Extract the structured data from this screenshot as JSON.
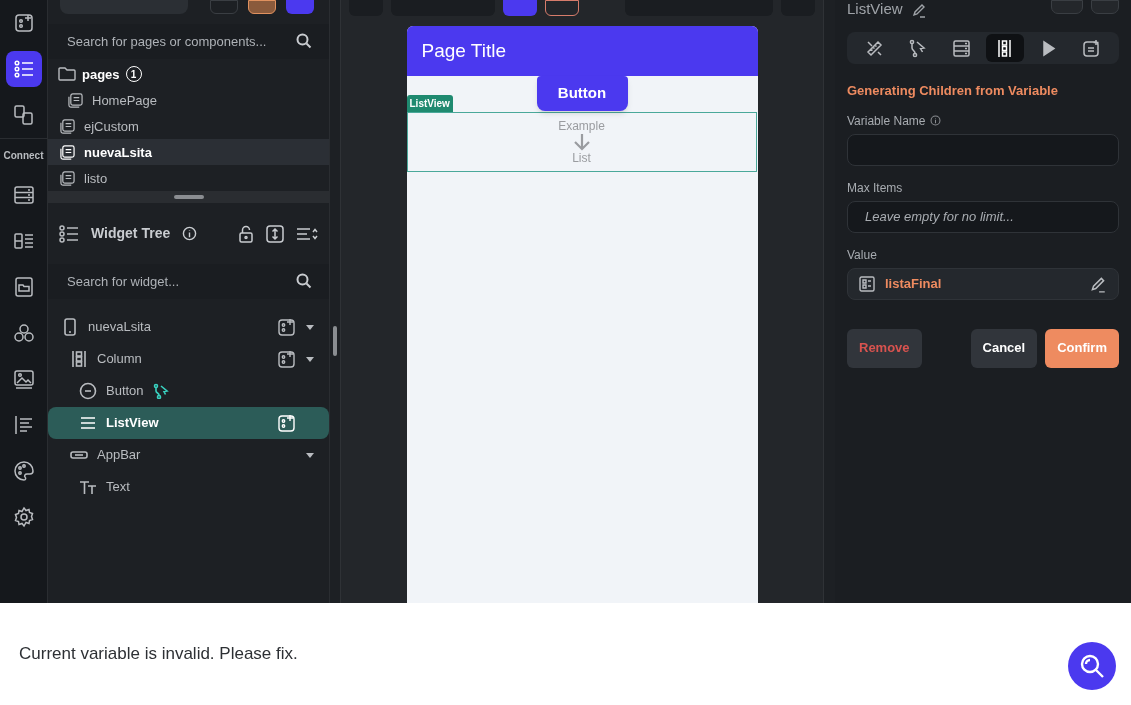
{
  "rail": {
    "items": [
      {
        "kind": "add",
        "selected": false
      },
      {
        "kind": "tree",
        "selected": true
      },
      {
        "kind": "swap",
        "selected": false
      },
      {
        "kind": "connect",
        "label": "Connect"
      },
      {
        "kind": "database",
        "selected": false
      },
      {
        "kind": "list",
        "selected": false
      },
      {
        "kind": "folder",
        "selected": false
      },
      {
        "kind": "hub",
        "selected": false
      },
      {
        "kind": "image",
        "selected": false
      },
      {
        "kind": "text",
        "selected": false
      },
      {
        "kind": "palette",
        "selected": false
      },
      {
        "kind": "settings",
        "selected": false
      }
    ]
  },
  "pages": {
    "search": {
      "placeholder": "Search for pages or components..."
    },
    "folder": {
      "label": "pages",
      "badge": "1",
      "children": [
        {
          "label": "HomePage",
          "selected": false
        }
      ]
    },
    "items": [
      {
        "label": "ejCustom",
        "selected": false
      },
      {
        "label": "nuevaLsita",
        "selected": true
      },
      {
        "label": "listo",
        "selected": false
      }
    ]
  },
  "widget_tree": {
    "title": "Widget Tree",
    "search": {
      "placeholder": "Search for widget..."
    },
    "nodes": [
      {
        "kind": "page",
        "label": "nuevaLsita",
        "selected": false,
        "add_button": true,
        "caret": true,
        "action": false,
        "children": [
          {
            "kind": "column",
            "label": "Column",
            "selected": false,
            "add_button": true,
            "caret": true,
            "action": false,
            "children": [
              {
                "kind": "button",
                "label": "Button",
                "selected": false,
                "add_button": false,
                "caret": false,
                "action": true
              },
              {
                "kind": "listview",
                "label": "ListView",
                "selected": true,
                "add_button": true,
                "caret": false,
                "action": false
              }
            ]
          },
          {
            "kind": "appbar",
            "label": "AppBar",
            "selected": false,
            "add_button": false,
            "caret": true,
            "action": false,
            "children": [
              {
                "kind": "text",
                "label": "Text",
                "selected": false,
                "add_button": false,
                "caret": false,
                "action": false
              }
            ]
          }
        ]
      }
    ]
  },
  "canvas": {
    "app_bar_title": "Page Title",
    "button": "Button",
    "listview_tag": "ListView",
    "placeholder_top": "Example",
    "placeholder_bottom": "List"
  },
  "properties": {
    "title": "ListView",
    "tabs": [
      {
        "kind": "design",
        "selected": false
      },
      {
        "kind": "actions",
        "selected": false
      },
      {
        "kind": "backend",
        "selected": false
      },
      {
        "kind": "generate",
        "selected": true
      },
      {
        "kind": "play",
        "selected": false
      },
      {
        "kind": "notes",
        "selected": false
      }
    ],
    "section_title": "Generating Children from Variable",
    "variable_name": {
      "label": "Variable Name"
    },
    "max_items": {
      "label": "Max Items",
      "placeholder": "Leave empty for no limit..."
    },
    "value": {
      "label": "Value",
      "value": "listaFinal"
    },
    "buttons": [
      {
        "kind": "remove",
        "label": "Remove"
      },
      {
        "kind": "cancel",
        "label": "Cancel"
      },
      {
        "kind": "confirm",
        "label": "Confirm"
      }
    ]
  },
  "message": "Current variable is invalid. Please fix."
}
